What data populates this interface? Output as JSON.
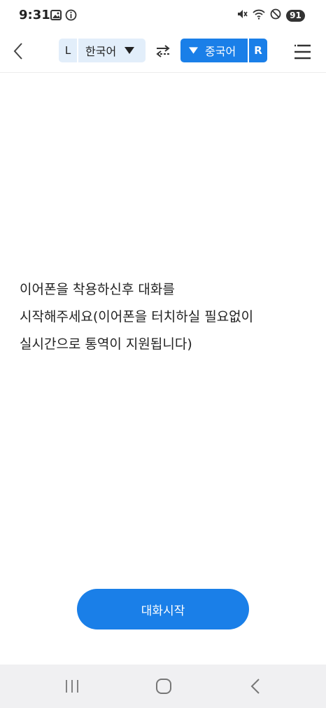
{
  "status_bar": {
    "time": "9:31",
    "battery": "91",
    "left_icons": [
      "image-icon",
      "info-icon"
    ],
    "right_icons": [
      "mute-icon",
      "wifi-icon",
      "do-not-disturb-icon",
      "battery-icon"
    ]
  },
  "header": {
    "left_badge": "L",
    "left_language": "한국어",
    "right_language": "중국어",
    "right_badge": "R",
    "accent_color": "#1a7fe8",
    "left_bg_color": "#e2eefa"
  },
  "main": {
    "instruction_text": "이어폰을 착용하신후 대화를\n시작해주세요(이어폰을 터치하실 필요없이\n실시간으로 통역이 지원됩니다)",
    "start_button_label": "대화시작"
  },
  "nav_bar": {
    "buttons": [
      "recent-apps-icon",
      "home-icon",
      "back-icon"
    ]
  }
}
